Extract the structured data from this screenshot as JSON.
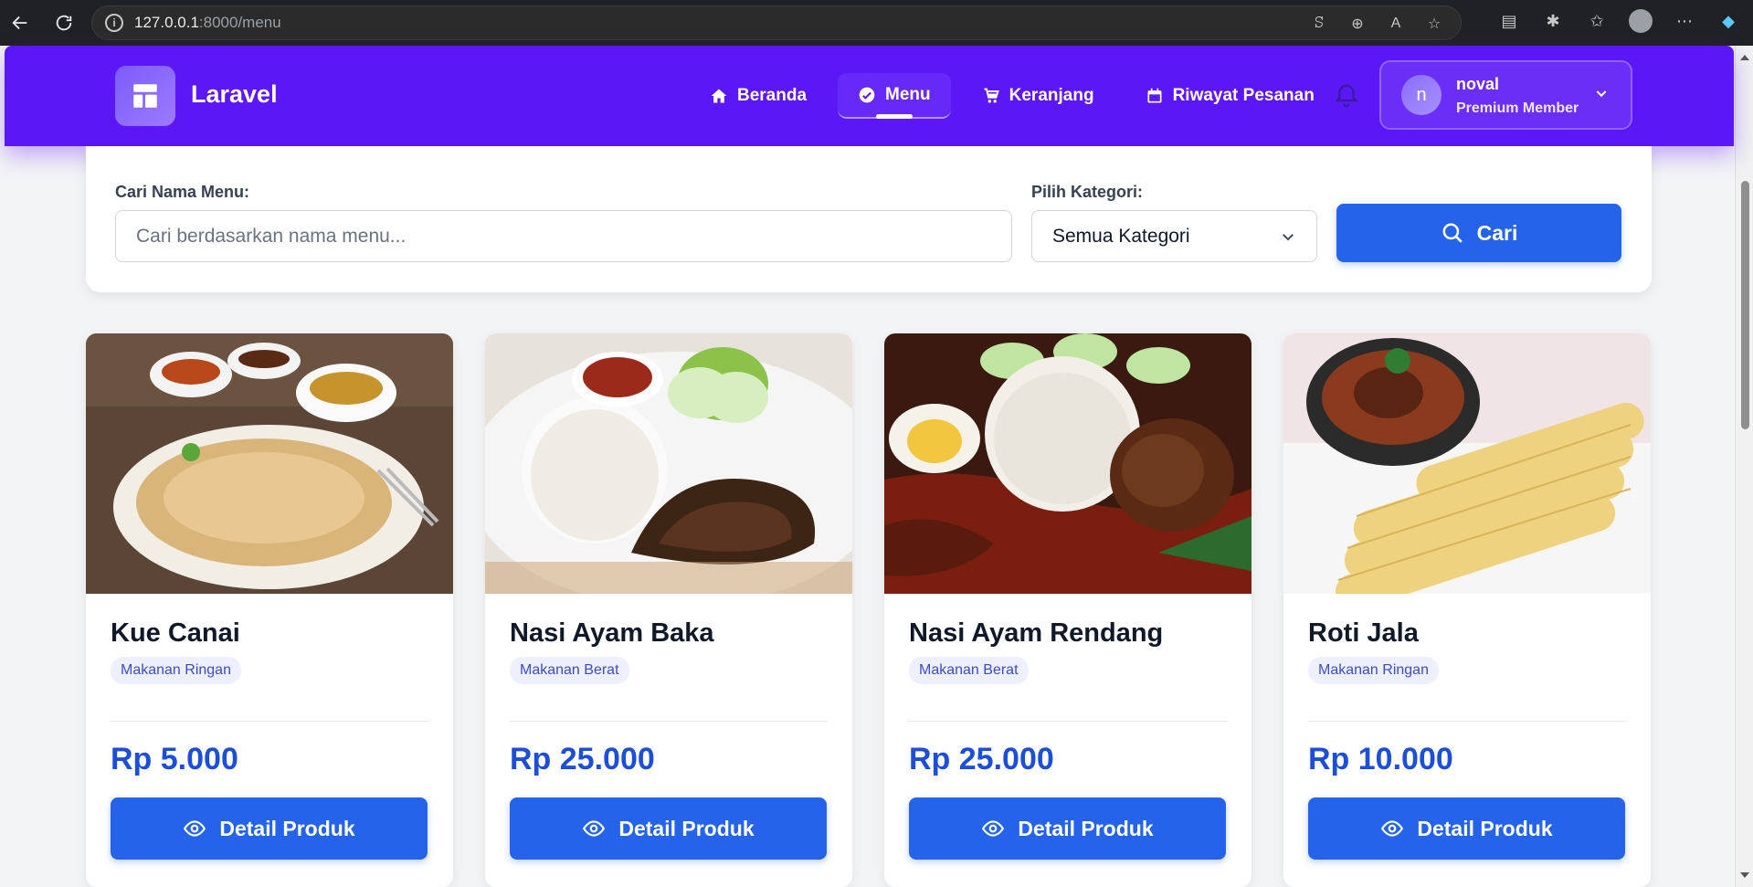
{
  "browser": {
    "url_host": "127.0.0.1",
    "url_path": ":8000/menu"
  },
  "nav": {
    "brand": "Laravel",
    "links": [
      {
        "label": "Beranda",
        "icon": "home-icon"
      },
      {
        "label": "Menu",
        "icon": "menu-icon",
        "active": true
      },
      {
        "label": "Keranjang",
        "icon": "cart-icon"
      },
      {
        "label": "Riwayat Pesanan",
        "icon": "calendar-icon"
      }
    ],
    "user": {
      "initial": "n",
      "name": "noval",
      "role": "Premium Member"
    }
  },
  "search": {
    "name_label": "Cari Nama Menu:",
    "name_placeholder": "Cari berdasarkan nama menu...",
    "category_label": "Pilih Kategori:",
    "category_selected": "Semua Kategori",
    "button_label": "Cari"
  },
  "products": [
    {
      "name": "Kue Canai",
      "category": "Makanan Ringan",
      "price": "Rp 5.000",
      "button": "Detail Produk"
    },
    {
      "name": "Nasi Ayam Baka",
      "category": "Makanan Berat",
      "price": "Rp 25.000",
      "button": "Detail Produk"
    },
    {
      "name": "Nasi Ayam Rendang",
      "category": "Makanan Berat",
      "price": "Rp 25.000",
      "button": "Detail Produk"
    },
    {
      "name": "Roti Jala",
      "category": "Makanan Ringan",
      "price": "Rp 10.000",
      "button": "Detail Produk"
    }
  ],
  "colors": {
    "nav_bg": "#5b17f5",
    "primary": "#2563eb",
    "price": "#1d4ed8"
  }
}
